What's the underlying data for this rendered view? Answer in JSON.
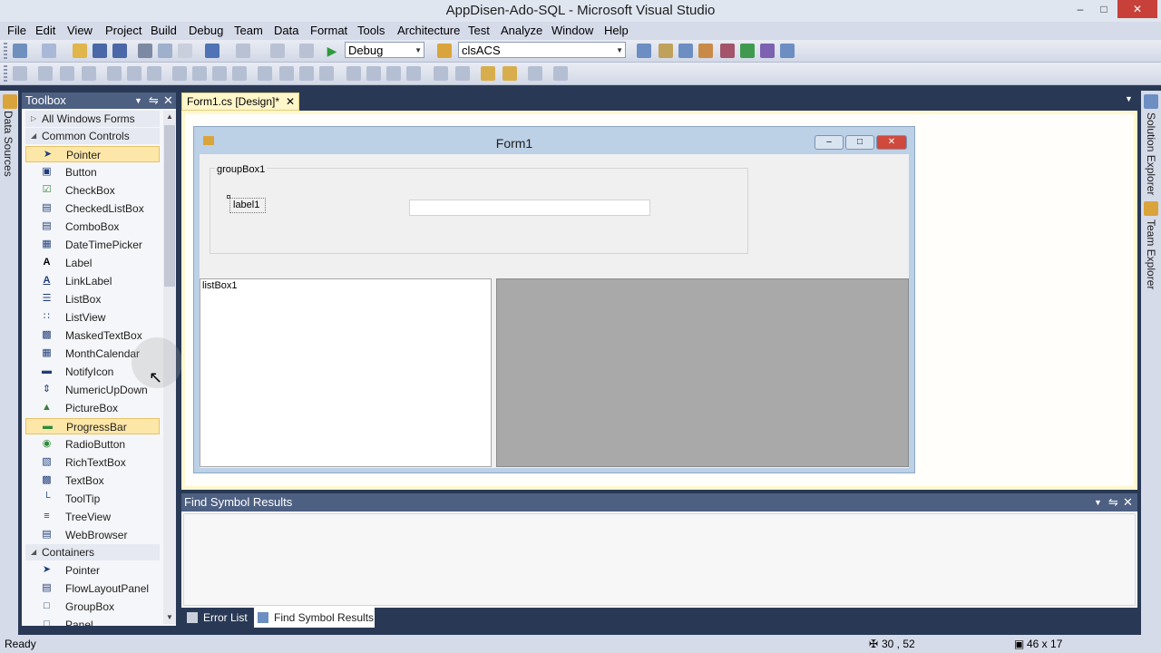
{
  "window": {
    "title": "AppDisen-Ado-SQL - Microsoft Visual Studio"
  },
  "menu": [
    "File",
    "Edit",
    "View",
    "Project",
    "Build",
    "Debug",
    "Team",
    "Data",
    "Format",
    "Tools",
    "Architecture",
    "Test",
    "Analyze",
    "Window",
    "Help"
  ],
  "toolbar": {
    "config_value": "Debug",
    "find_value": "clsACS"
  },
  "side_tabs": {
    "left": "Data Sources",
    "right_top": "Solution Explorer",
    "right_bottom": "Team Explorer"
  },
  "toolbox": {
    "title": "Toolbox",
    "categories": {
      "all": "All Windows Forms",
      "common": "Common Controls",
      "containers": "Containers"
    },
    "common_items": [
      "Pointer",
      "Button",
      "CheckBox",
      "CheckedListBox",
      "ComboBox",
      "DateTimePicker",
      "Label",
      "LinkLabel",
      "ListBox",
      "ListView",
      "MaskedTextBox",
      "MonthCalendar",
      "NotifyIcon",
      "NumericUpDown",
      "PictureBox",
      "ProgressBar",
      "RadioButton",
      "RichTextBox",
      "TextBox",
      "ToolTip",
      "TreeView",
      "WebBrowser"
    ],
    "container_items": [
      "Pointer",
      "FlowLayoutPanel",
      "GroupBox",
      "Panel"
    ]
  },
  "document": {
    "tab_label": "Form1.cs [Design]*"
  },
  "form": {
    "title": "Form1",
    "groupbox_label": "groupBox1",
    "label_text": "label1",
    "listbox_label": "listBox1"
  },
  "find_symbol": {
    "title": "Find Symbol Results"
  },
  "bottom_tabs": {
    "error_list": "Error List",
    "find_symbol": "Find Symbol Results"
  },
  "status": {
    "text": "Ready",
    "position": "30 , 52",
    "size": "46 x 17"
  }
}
